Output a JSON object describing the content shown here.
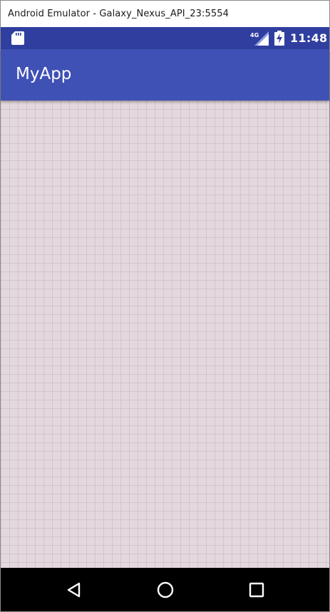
{
  "window": {
    "title": "Android Emulator - Galaxy_Nexus_API_23:5554"
  },
  "status_bar": {
    "network_type": "4G",
    "time": "11:48",
    "icons": [
      "sd-card-icon",
      "signal-4g-icon",
      "battery-charging-icon"
    ]
  },
  "app_bar": {
    "title": "MyApp"
  },
  "nav_bar": {
    "buttons": [
      "back-icon",
      "home-icon",
      "recents-icon"
    ]
  },
  "colors": {
    "status_bar": "#303f9f",
    "app_bar": "#3f51b5",
    "content_background": "#e3d8de",
    "nav_bar": "#000000"
  }
}
